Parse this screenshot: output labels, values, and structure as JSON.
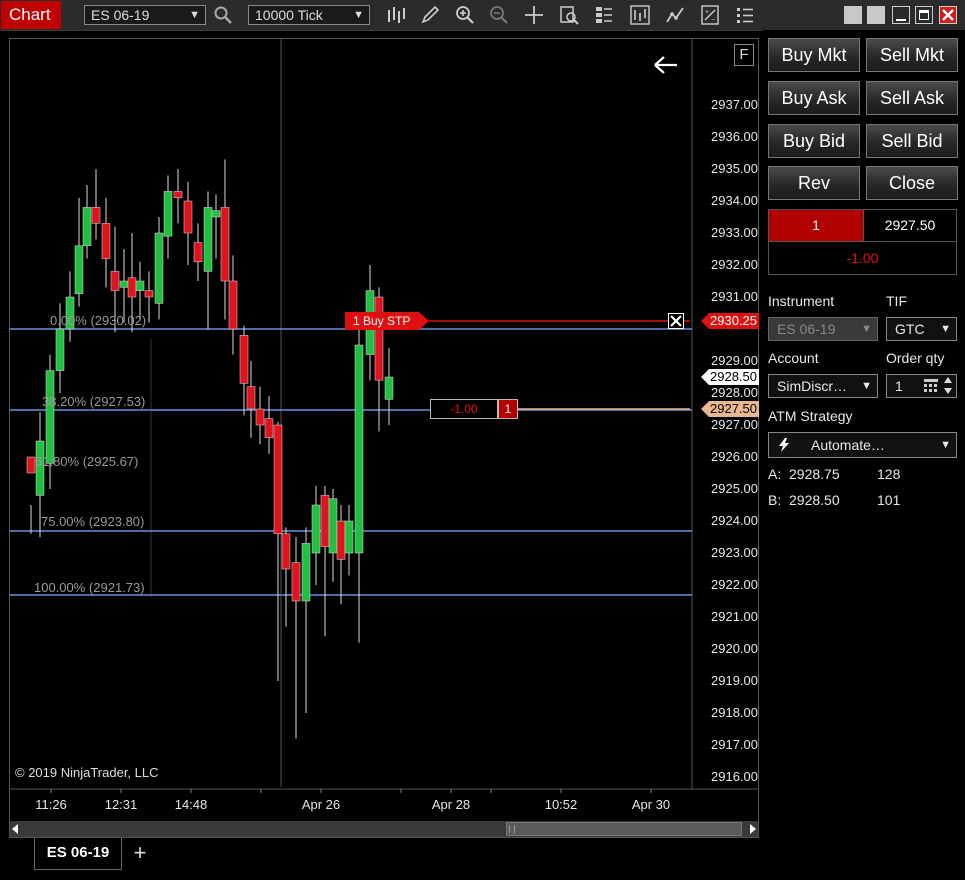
{
  "toolbar": {
    "title": "Chart",
    "instrument": "ES 06-19",
    "interval": "10000 Tick"
  },
  "chart": {
    "price_ticks": [
      "2937.00",
      "2936.00",
      "2935.00",
      "2934.00",
      "2933.00",
      "2932.00",
      "2931.00",
      "2929.00",
      "2927.00",
      "2926.00",
      "2925.00",
      "2924.00",
      "2923.00",
      "2922.00",
      "2921.00",
      "2920.00",
      "2919.00",
      "2918.00",
      "2917.00",
      "2916.00"
    ],
    "price_marker_stop": "2930.25",
    "price_marker_last": "2928.50",
    "price_marker_label": "2928.00",
    "price_marker_position": "2927.50",
    "time_labels": [
      "11:26",
      "12:31",
      "14:48",
      "Apr 26",
      "Apr 28",
      "10:52",
      "Apr 30"
    ],
    "fib_levels": [
      "0.00% (2930.02)",
      "38.20% (2927.53)",
      "61.80% (2925.67)",
      "75.00% (2923.80)",
      "100.00% (2921.73)"
    ],
    "order_label": "1  Buy STP",
    "position_pnl": "-1.00",
    "position_qty": "1",
    "copyright": "© 2019 NinjaTrader, LLC",
    "f_button": "F",
    "colors": {
      "up": "#22c040",
      "down": "#e0141e",
      "fib": "#6b8fe0",
      "stop": "#d11",
      "position": "#e9b890"
    }
  },
  "bottom_tab": {
    "label": "ES 06-19",
    "add": "+"
  },
  "trade_panel": {
    "buttons": [
      [
        "Buy Mkt",
        "Sell Mkt"
      ],
      [
        "Buy Ask",
        "Sell Ask"
      ],
      [
        "Buy Bid",
        "Sell Bid"
      ],
      [
        "Rev",
        "Close"
      ]
    ],
    "position_qty": "1",
    "position_price": "2927.50",
    "pnl": "-1.00",
    "instrument_label": "Instrument",
    "instrument_value": "ES 06-19",
    "tif_label": "TIF",
    "tif_value": "GTC",
    "account_label": "Account",
    "account_value": "SimDiscr…",
    "order_qty_label": "Order qty",
    "order_qty_value": "1",
    "atm_label": "ATM Strategy",
    "atm_value": "Automate…",
    "ask_label": "A:",
    "ask_price": "2928.75",
    "ask_size": "128",
    "bid_label": "B:",
    "bid_price": "2928.50",
    "bid_size": "101"
  }
}
